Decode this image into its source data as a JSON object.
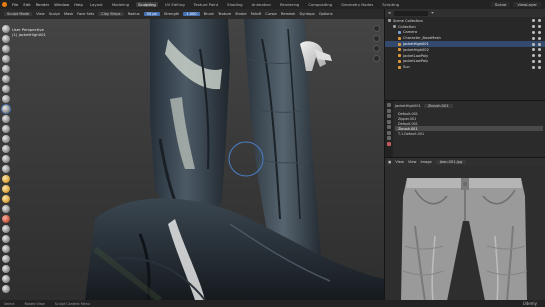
{
  "topbar": {
    "menus": [
      "File",
      "Edit",
      "Render",
      "Window",
      "Help"
    ],
    "workspaces": [
      "Layout",
      "Modeling",
      "Sculpting",
      "UV Editing",
      "Texture Paint",
      "Shading",
      "Animation",
      "Rendering",
      "Compositing",
      "Geometry Nodes",
      "Scripting"
    ],
    "active_workspace": "Sculpting",
    "scene": "Scene",
    "view_layer": "ViewLayer"
  },
  "toolheader": {
    "mode": "Sculpt Mode",
    "menus": [
      "View",
      "Sculpt",
      "Mask",
      "Face Sets"
    ],
    "brush": "Clay Strips",
    "radius_label": "Radius",
    "radius": "50 px",
    "strength_label": "Strength",
    "strength": "1.000",
    "options": [
      "Brush",
      "Texture",
      "Stroke",
      "Falloff",
      "Cursor"
    ],
    "symmetry": "Remesh",
    "options2": [
      "Dyntopo",
      "Options"
    ]
  },
  "viewport": {
    "view_name": "User Perspective",
    "object_name": "(1) jacketHigh001"
  },
  "outliner": {
    "header_label": "Scene Collection",
    "rows": [
      {
        "label": "Scene Collection",
        "indent": 0,
        "type": "coll",
        "selected": false
      },
      {
        "label": "Collection",
        "indent": 1,
        "type": "coll",
        "selected": false
      },
      {
        "label": "Camera",
        "indent": 2,
        "type": "cam",
        "selected": false
      },
      {
        "label": "Character_BaseMesh",
        "indent": 2,
        "type": "mesh",
        "selected": false
      },
      {
        "label": "jacketHigh001",
        "indent": 2,
        "type": "mesh",
        "selected": true
      },
      {
        "label": "jacketHigh002",
        "indent": 2,
        "type": "mesh",
        "selected": false
      },
      {
        "label": "jacketLowPoly",
        "indent": 2,
        "type": "mesh",
        "selected": false
      },
      {
        "label": "jacketLowPoly",
        "indent": 2,
        "type": "mesh",
        "selected": false
      },
      {
        "label": "Sun",
        "indent": 2,
        "type": "mesh",
        "selected": false
      }
    ]
  },
  "properties": {
    "object": "jacketHigh001",
    "material": "Zbrush.001",
    "slots": [
      "Default.001",
      "Zipper.001",
      "Default.001",
      "Zbrush.001",
      "T-1.Default.001"
    ],
    "selected_slot": 3
  },
  "imageeditor": {
    "menus": [
      "View",
      "View",
      "Image"
    ],
    "image": "Jean.001.jpg"
  },
  "statusbar": {
    "items": [
      "Select",
      "Rotate View",
      "Sculpt Context Menu"
    ],
    "watermark": "Udemy"
  }
}
